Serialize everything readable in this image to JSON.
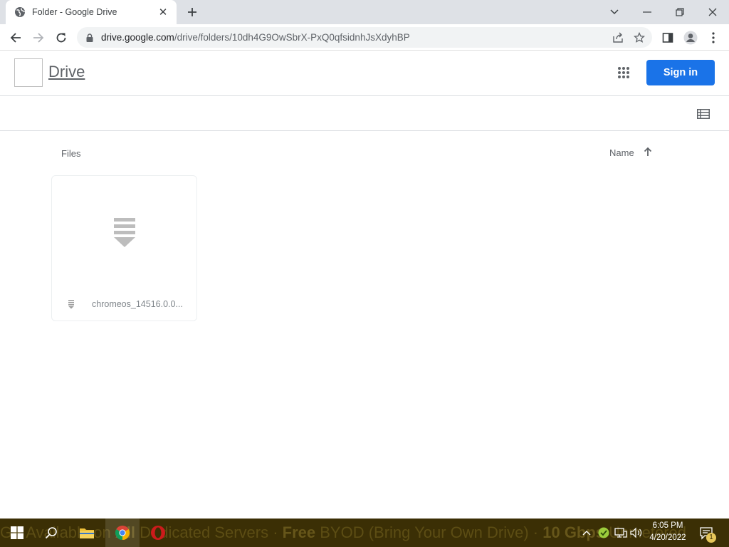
{
  "browser": {
    "tab_title": "Folder - Google Drive",
    "tab_close": "✕",
    "url_host": "drive.google.com",
    "url_path": "/drive/folders/10dh4G9OwSbrX-PxQ0qfsidnhJsXdyhBP"
  },
  "drive": {
    "app_name": "Drive",
    "signin_label": "Sign in",
    "files_label": "Files",
    "sort_label": "Name",
    "files": [
      {
        "name": "chromeos_14516.0.0...",
        "icon": "archive-icon"
      }
    ]
  },
  "taskbar": {
    "ticker_prefix": "GP Available on ",
    "ticker_bold1": "All",
    "ticker_mid": " Dedicated Servers · ",
    "ticker_bold2": "Free",
    "ticker_rest": " BYOD (Bring Your Own Drive) · ",
    "ticker_bold3": "10 Gbps",
    "ticker_tail": " Unmetered",
    "time": "6:05 PM",
    "date": "4/20/2022",
    "notification_count": "1"
  },
  "colors": {
    "accent": "#1a73e8",
    "taskbar": "#3b2f05"
  }
}
